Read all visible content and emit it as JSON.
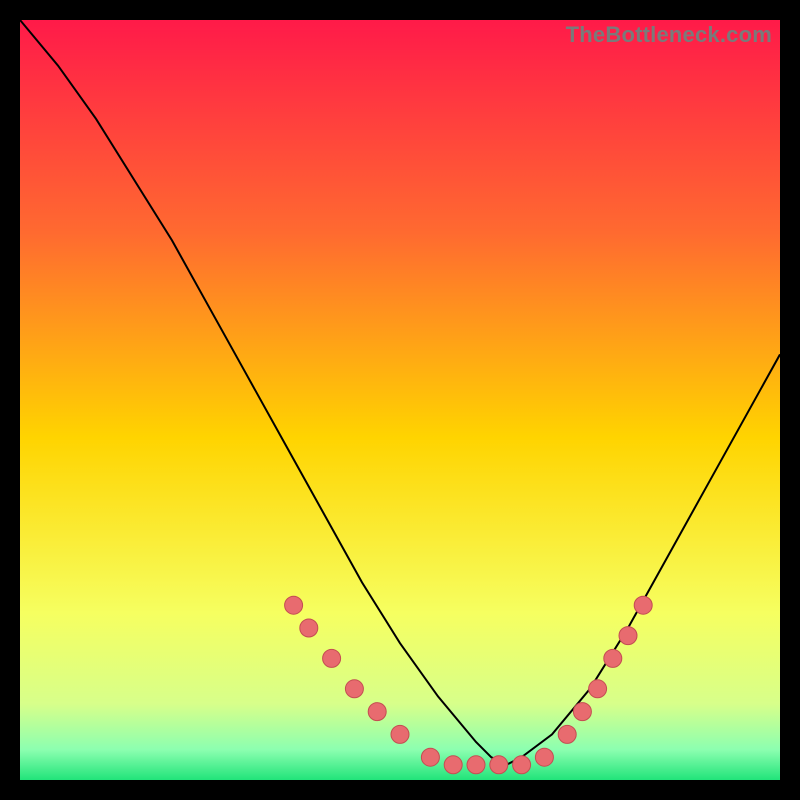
{
  "watermark": "TheBottleneck.com",
  "colors": {
    "bg": "#000000",
    "grad_top": "#ff1a49",
    "grad_mid1": "#ff7a2a",
    "grad_mid2": "#ffd400",
    "grad_mid3": "#f3ff55",
    "grad_bottom": "#21e47a",
    "curve": "#000000",
    "dot_fill": "#e86b6f",
    "dot_stroke": "#c44d52"
  },
  "chart_data": {
    "type": "line",
    "title": "",
    "xlabel": "",
    "ylabel": "",
    "xlim": [
      0,
      100
    ],
    "ylim": [
      0,
      100
    ],
    "series": [
      {
        "name": "bottleneck-curve",
        "x": [
          0,
          5,
          10,
          15,
          20,
          25,
          30,
          35,
          40,
          45,
          50,
          55,
          60,
          62,
          64,
          66,
          70,
          75,
          80,
          85,
          90,
          95,
          100
        ],
        "y": [
          100,
          94,
          87,
          79,
          71,
          62,
          53,
          44,
          35,
          26,
          18,
          11,
          5,
          3,
          2,
          3,
          6,
          12,
          20,
          29,
          38,
          47,
          56
        ]
      }
    ],
    "points": [
      {
        "x": 36,
        "y": 23
      },
      {
        "x": 38,
        "y": 20
      },
      {
        "x": 41,
        "y": 16
      },
      {
        "x": 44,
        "y": 12
      },
      {
        "x": 47,
        "y": 9
      },
      {
        "x": 50,
        "y": 6
      },
      {
        "x": 54,
        "y": 3
      },
      {
        "x": 57,
        "y": 2
      },
      {
        "x": 60,
        "y": 2
      },
      {
        "x": 63,
        "y": 2
      },
      {
        "x": 66,
        "y": 2
      },
      {
        "x": 69,
        "y": 3
      },
      {
        "x": 72,
        "y": 6
      },
      {
        "x": 74,
        "y": 9
      },
      {
        "x": 76,
        "y": 12
      },
      {
        "x": 78,
        "y": 16
      },
      {
        "x": 80,
        "y": 19
      },
      {
        "x": 82,
        "y": 23
      }
    ]
  }
}
